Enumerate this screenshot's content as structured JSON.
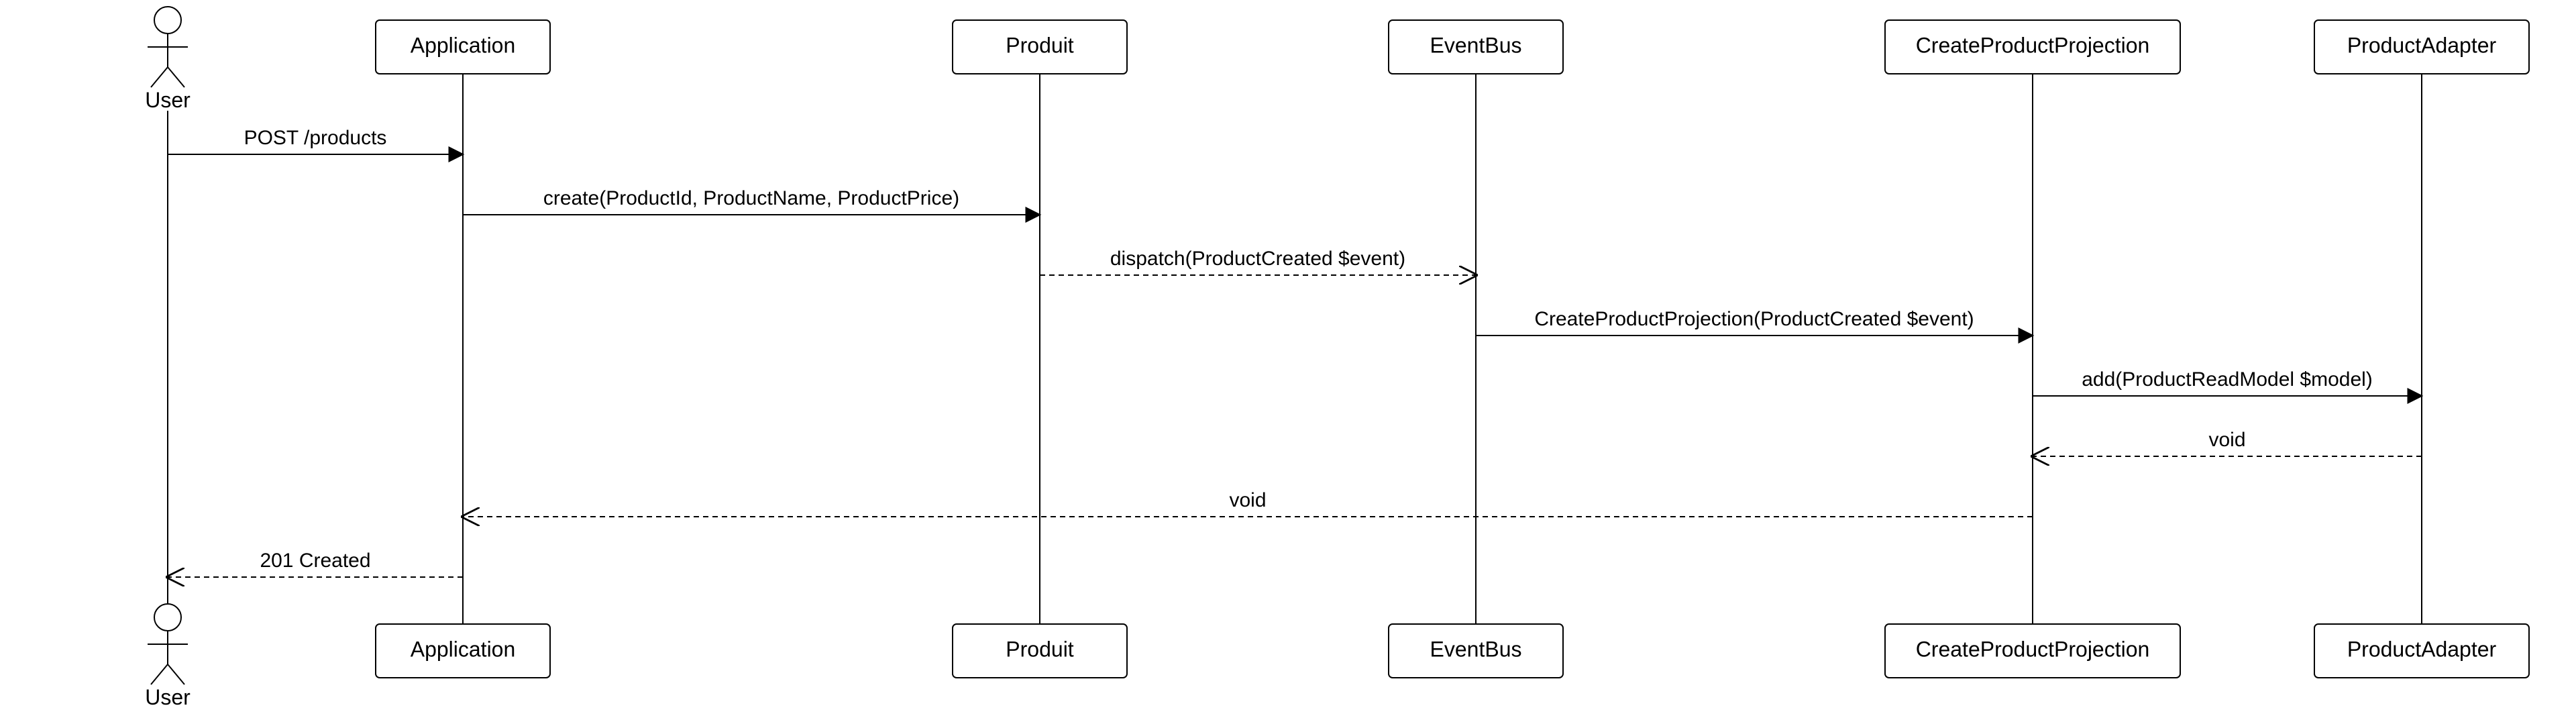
{
  "actor": {
    "name": "User"
  },
  "lifelines": {
    "app": {
      "label": "Application"
    },
    "produit": {
      "label": "Produit"
    },
    "bus": {
      "label": "EventBus"
    },
    "proj": {
      "label": "CreateProductProjection"
    },
    "adapter": {
      "label": "ProductAdapter"
    }
  },
  "messages": {
    "m1": {
      "label": "POST /products"
    },
    "m2": {
      "label": "create(ProductId, ProductName, ProductPrice)"
    },
    "m3": {
      "label": "dispatch(ProductCreated $event)"
    },
    "m4": {
      "label": "CreateProductProjection(ProductCreated $event)"
    },
    "m5": {
      "label": "add(ProductReadModel $model)"
    },
    "m6": {
      "label": "void"
    },
    "m7": {
      "label": "void"
    },
    "m8": {
      "label": "201 Created"
    }
  },
  "chart_data": {
    "type": "sequence-diagram",
    "actor": "User",
    "participants": [
      "Application",
      "Produit",
      "EventBus",
      "CreateProductProjection",
      "ProductAdapter"
    ],
    "messages": [
      {
        "from": "User",
        "to": "Application",
        "text": "POST /products",
        "kind": "sync"
      },
      {
        "from": "Application",
        "to": "Produit",
        "text": "create(ProductId, ProductName, ProductPrice)",
        "kind": "sync"
      },
      {
        "from": "Produit",
        "to": "EventBus",
        "text": "dispatch(ProductCreated $event)",
        "kind": "async"
      },
      {
        "from": "EventBus",
        "to": "CreateProductProjection",
        "text": "CreateProductProjection(ProductCreated $event)",
        "kind": "sync"
      },
      {
        "from": "CreateProductProjection",
        "to": "ProductAdapter",
        "text": "add(ProductReadModel $model)",
        "kind": "sync"
      },
      {
        "from": "ProductAdapter",
        "to": "CreateProductProjection",
        "text": "void",
        "kind": "return"
      },
      {
        "from": "CreateProductProjection",
        "to": "Application",
        "text": "void",
        "kind": "return"
      },
      {
        "from": "Application",
        "to": "User",
        "text": "201 Created",
        "kind": "return"
      }
    ]
  }
}
